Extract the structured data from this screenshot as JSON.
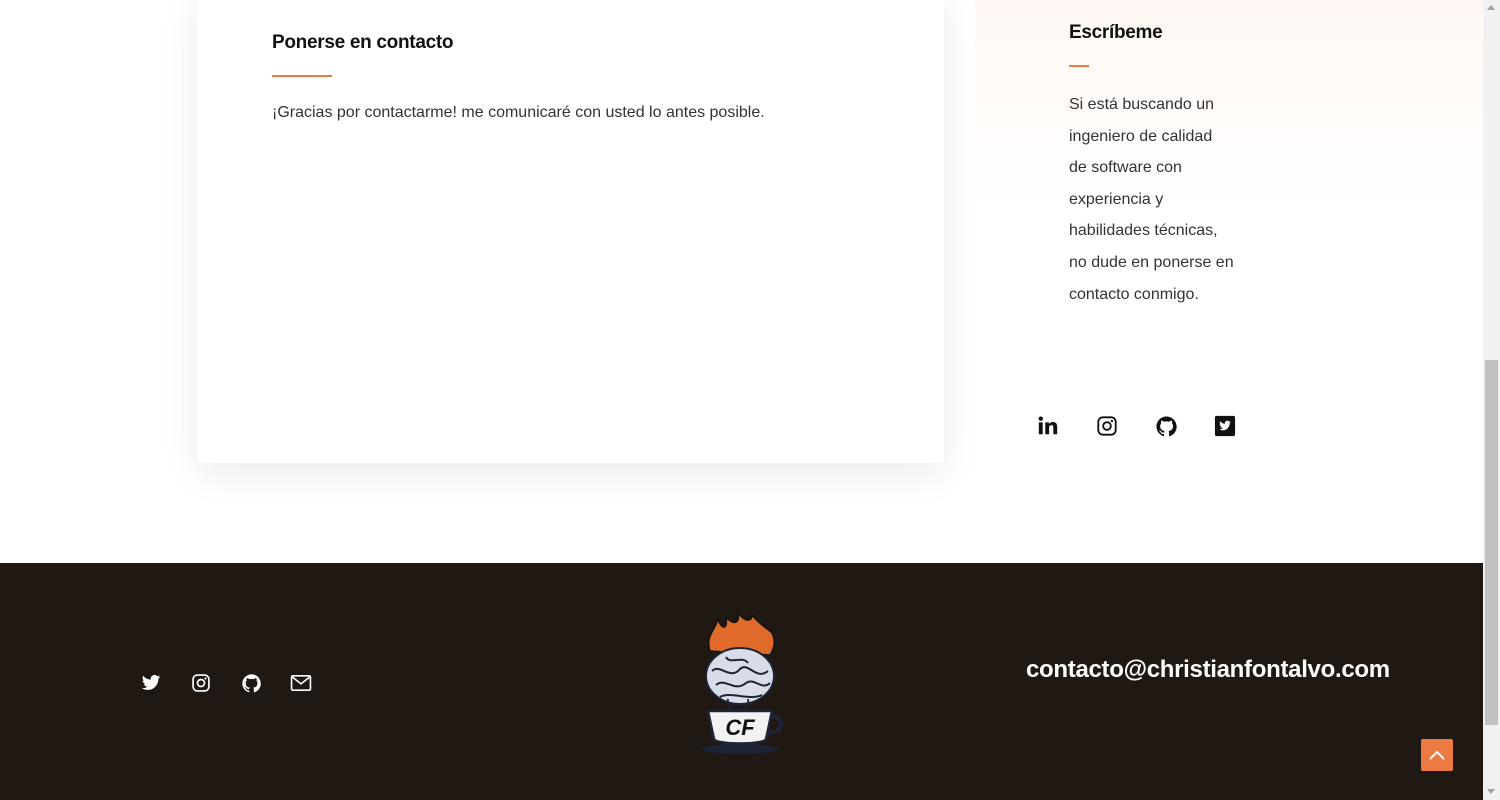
{
  "contact_card": {
    "title": "Ponerse en contacto",
    "message": "¡Gracias por contactarme! me comunicaré con usted lo antes posible."
  },
  "sidebar": {
    "title": "Escríbeme",
    "text": "Si está buscando un ingeniero de calidad de software con experiencia y habilidades técnicas, no dude en ponerse en contacto conmigo.",
    "social_icons": [
      "linkedin-icon",
      "instagram-icon",
      "github-icon",
      "twitter-square-icon"
    ]
  },
  "footer": {
    "social_icons": [
      "twitter-icon",
      "instagram-icon",
      "github-icon",
      "email-icon"
    ],
    "logo_text": "CF",
    "email": "contacto@christianfontalvo.com"
  },
  "colors": {
    "accent": "#ee7a43",
    "footer_bg": "#1f1813",
    "text_dark": "#111111"
  }
}
